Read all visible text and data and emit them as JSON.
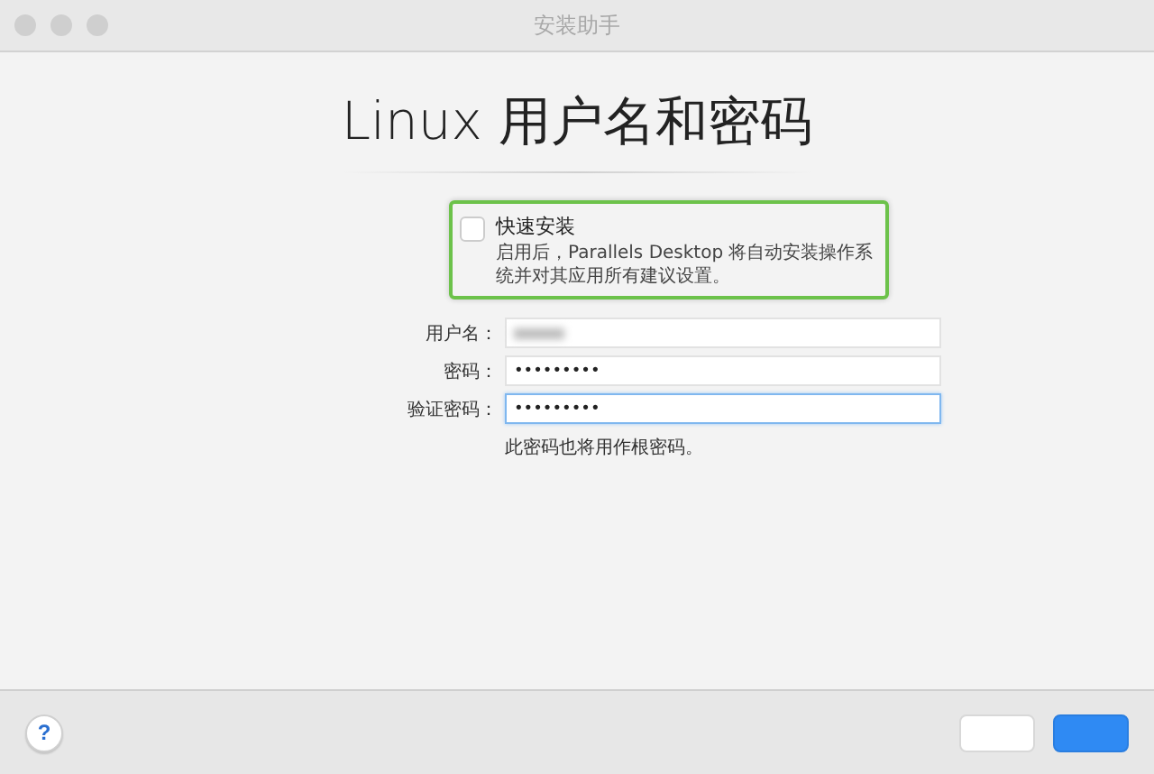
{
  "window": {
    "title": "安装助手"
  },
  "heading": "Linux 用户名和密码",
  "express_install": {
    "label": "快速安装",
    "checked": false,
    "description": "启用后，Parallels Desktop 将自动安装操作系统并对其应用所有建议设置。"
  },
  "fields": [
    {
      "label": "用户名：",
      "kind": "blurred",
      "focused": false
    },
    {
      "label": "密码：",
      "kind": "password",
      "value": "•••••••••",
      "focused": false
    },
    {
      "label": "验证密码：",
      "kind": "password",
      "value": "•••••••••",
      "focused": true
    }
  ],
  "hint": "此密码也将用作根密码。",
  "footer": {
    "help": "?",
    "buttons": [
      {
        "kind": "secondary"
      },
      {
        "kind": "primary"
      }
    ]
  }
}
